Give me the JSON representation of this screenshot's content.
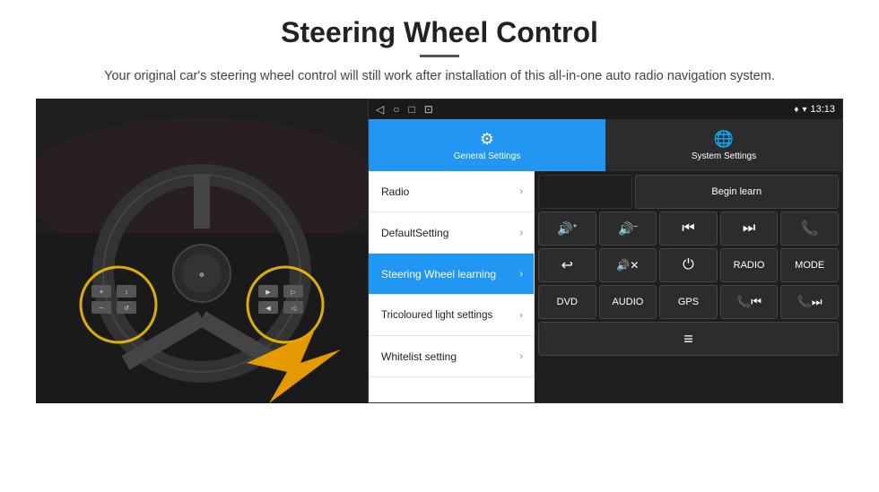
{
  "header": {
    "title": "Steering Wheel Control",
    "divider": true,
    "subtitle": "Your original car's steering wheel control will still work after installation of this all-in-one auto radio navigation system."
  },
  "android_ui": {
    "status_bar": {
      "icons": [
        "◁",
        "○",
        "□",
        "⊡"
      ],
      "time": "13:13",
      "wifi_gps": "♥ ▾"
    },
    "tabs": [
      {
        "label": "General Settings",
        "icon": "⚙",
        "active": true
      },
      {
        "label": "System Settings",
        "icon": "🌐",
        "active": false
      }
    ],
    "menu_items": [
      {
        "label": "Radio",
        "active": false
      },
      {
        "label": "DefaultSetting",
        "active": false
      },
      {
        "label": "Steering Wheel learning",
        "active": true
      },
      {
        "label": "Tricoloured light settings",
        "active": false
      },
      {
        "label": "Whitelist setting",
        "active": false
      }
    ],
    "controls": {
      "row1": [
        {
          "label": "",
          "empty": true
        },
        {
          "label": "Begin learn",
          "wide": true
        }
      ],
      "row2": [
        {
          "label": "🔊+",
          "icon": true
        },
        {
          "label": "🔊–",
          "icon": true
        },
        {
          "label": "⏮",
          "icon": true
        },
        {
          "label": "⏭",
          "icon": true
        },
        {
          "label": "📞",
          "icon": true
        }
      ],
      "row3": [
        {
          "label": "↩",
          "icon": true
        },
        {
          "label": "🔊✕",
          "icon": true
        },
        {
          "label": "⏻",
          "icon": true
        },
        {
          "label": "RADIO",
          "icon": false
        },
        {
          "label": "MODE",
          "icon": false
        }
      ],
      "row4": [
        {
          "label": "DVD",
          "icon": false
        },
        {
          "label": "AUDIO",
          "icon": false
        },
        {
          "label": "GPS",
          "icon": false
        },
        {
          "label": "📞⏮",
          "icon": true
        },
        {
          "label": "📞⏭",
          "icon": true
        }
      ],
      "row5": [
        {
          "label": "≡",
          "icon": true,
          "single": true
        }
      ]
    }
  }
}
